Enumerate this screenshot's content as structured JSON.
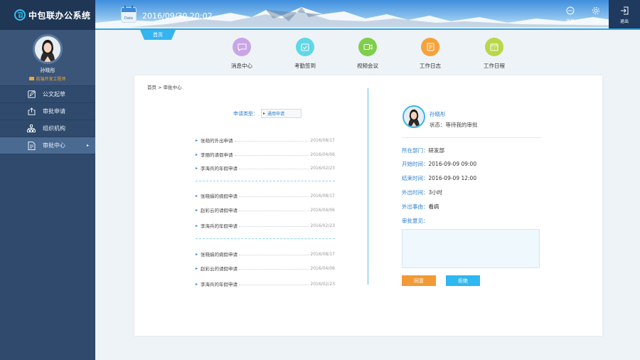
{
  "app": {
    "title": "中包联办公系统"
  },
  "user": {
    "name": "孙晓彤",
    "role": "前端开发工程师"
  },
  "sidebar": {
    "items": [
      {
        "label": "公文起草",
        "icon": "edit-icon"
      },
      {
        "label": "审批申请",
        "icon": "upload-icon"
      },
      {
        "label": "组织机构",
        "icon": "org-chart-icon"
      },
      {
        "label": "审批中心",
        "icon": "document-icon",
        "active": true
      }
    ]
  },
  "header": {
    "date_icon_label": "Date",
    "datetime": "2016/09/30 20:02",
    "messages_label": "消息",
    "settings_label": "设置",
    "exit_label": "退出",
    "home_tab": "首页"
  },
  "quick_links": [
    {
      "label": "消息中心",
      "color": "#c9a5e6",
      "icon": "message-icon"
    },
    {
      "label": "考勤签到",
      "color": "#5fd8e6",
      "icon": "checkin-icon"
    },
    {
      "label": "视频会议",
      "color": "#7fcf4a",
      "icon": "video-icon"
    },
    {
      "label": "工作日志",
      "color": "#f6a23a",
      "icon": "notebook-icon"
    },
    {
      "label": "工作日程",
      "color": "#b8d74a",
      "icon": "calendar-icon"
    }
  ],
  "main": {
    "breadcrumb": "首页 > 审批中心",
    "filter": {
      "label": "申请类型：",
      "value": "通用申请"
    },
    "applications": [
      [
        {
          "name": "张萌的外出申请",
          "date": "2016/08/17"
        },
        {
          "name": "李丽的请假申请",
          "date": "2016/04/06"
        },
        {
          "name": "李海兵的年假申请",
          "date": "2016/02/23"
        }
      ],
      [
        {
          "name": "张晓娟的病假申请",
          "date": "2016/08/17"
        },
        {
          "name": "赵彩云的请假申请",
          "date": "2016/04/06"
        },
        {
          "name": "李海兵的年假申请",
          "date": "2016/02/23"
        }
      ],
      [
        {
          "name": "张晓娟的病假申请",
          "date": "2016/08/17"
        },
        {
          "name": "赵彩云的请假申请",
          "date": "2016/04/06"
        },
        {
          "name": "李海兵的年假申请",
          "date": "2016/02/23"
        }
      ]
    ]
  },
  "detail": {
    "name": "孙晓彤",
    "status": "状态：等待我的审批",
    "fields": [
      {
        "key": "所在部门：",
        "value": "研发部"
      },
      {
        "key": "开始时间：",
        "value": "2016-09-09  09:00"
      },
      {
        "key": "结束时间：",
        "value": "2016-09-09  12:00"
      },
      {
        "key": "外出时间：",
        "value": "3小时"
      },
      {
        "key": "外出事由：",
        "value": "看病"
      },
      {
        "key": "审批意见：",
        "value": ""
      }
    ],
    "approve_label": "同意",
    "reject_label": "拒绝"
  },
  "colors": {
    "sidebar_bg": "#2f4a6c",
    "accent_blue": "#35b5ef",
    "approve": "#f29a36",
    "reject": "#2fb7ef"
  }
}
